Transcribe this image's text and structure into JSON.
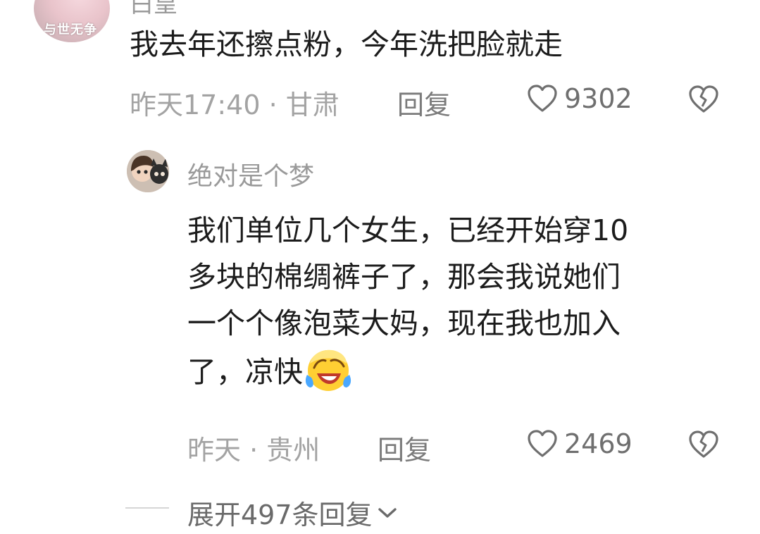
{
  "comment": {
    "username": "白皇",
    "avatar_text": "与世无争",
    "text": "我去年还擦点粉，今年洗把脸就走",
    "meta": "昨天17:40 · 甘肃",
    "reply_label": "回复",
    "like_count": "9302",
    "icons": {
      "like": "heart-outline-icon",
      "dislike": "broken-heart-icon"
    }
  },
  "reply": {
    "username": "绝对是个梦",
    "lines": [
      "我们单位几个女生，已经开始穿10",
      "多块的棉绸裤子了，那会我说她们",
      "一个个像泡菜大妈，现在我也加入",
      "了，凉快"
    ],
    "emoji": "laughing-crying-face-emoji",
    "meta": "昨天 · 贵州",
    "reply_label": "回复",
    "like_count": "2469",
    "icons": {
      "like": "heart-outline-icon",
      "dislike": "broken-heart-icon"
    }
  },
  "expand": {
    "label": "展开497条回复",
    "icon": "chevron-down-icon"
  },
  "colors": {
    "text_primary": "#1c1c1c",
    "text_meta": "#a3a3a3",
    "text_action": "#7b7b7b",
    "divider": "#d6d6d6"
  }
}
